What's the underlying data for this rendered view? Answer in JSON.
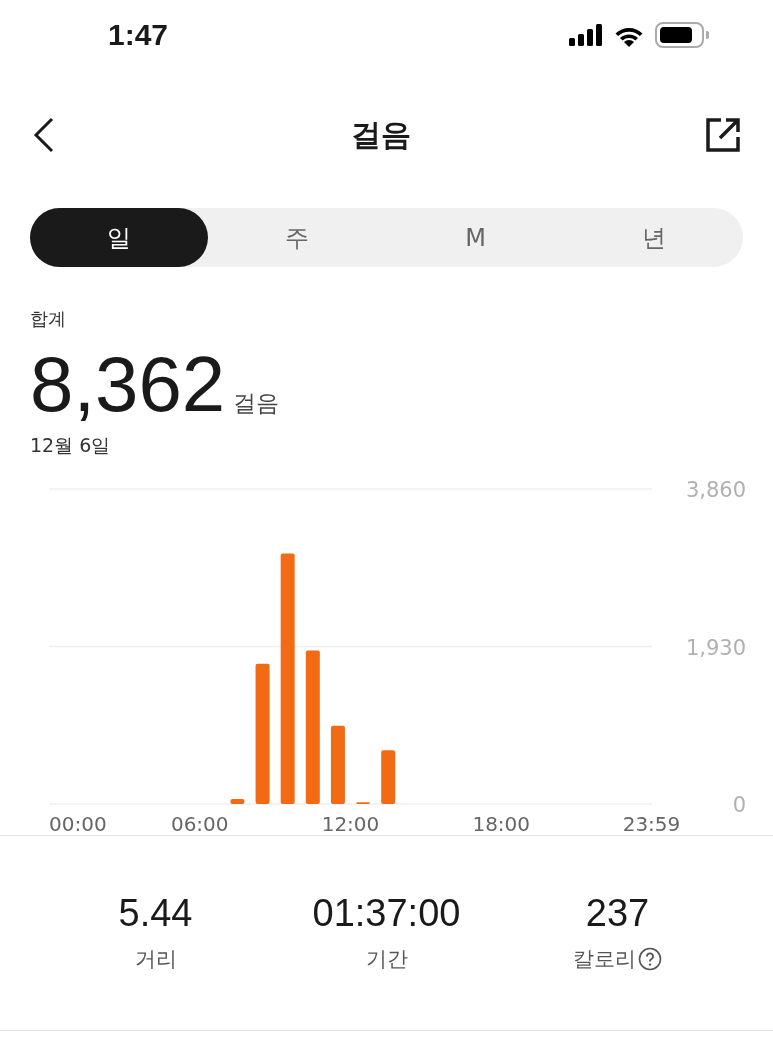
{
  "status_bar": {
    "time": "1:47"
  },
  "header": {
    "title": "걸음"
  },
  "tabs": [
    {
      "label": "일",
      "selected": true
    },
    {
      "label": "주",
      "selected": false
    },
    {
      "label": "M",
      "selected": false
    },
    {
      "label": "년",
      "selected": false
    }
  ],
  "summary": {
    "label": "합계",
    "value": "8,362",
    "unit": "걸음",
    "date": "12월 6일"
  },
  "chart_data": {
    "type": "bar",
    "x": [
      7.5,
      8.5,
      9.5,
      10.5,
      11.5,
      12.5,
      13.5
    ],
    "series": [
      {
        "color": "#f26b14",
        "values": [
          60,
          1720,
          3070,
          1880,
          960,
          20,
          660
        ]
      }
    ],
    "xlim": [
      0,
      24
    ],
    "ylim": [
      0,
      3860
    ],
    "xticks": [
      {
        "value": 0,
        "label": "00:00"
      },
      {
        "value": 6,
        "label": "06:00"
      },
      {
        "value": 12,
        "label": "12:00"
      },
      {
        "value": 18,
        "label": "18:00"
      },
      {
        "value": 23.98,
        "label": "23:59"
      }
    ],
    "yticks": [
      {
        "value": 0,
        "label": "0"
      },
      {
        "value": 1930,
        "label": "1,930"
      },
      {
        "value": 3860,
        "label": "3,860"
      }
    ]
  },
  "stats": [
    {
      "value": "5.44",
      "label": "거리",
      "kind": "plain"
    },
    {
      "value": "01:37:00",
      "label": "기간",
      "kind": "plain"
    },
    {
      "value": "237",
      "label": "칼로리",
      "kind": "help"
    }
  ]
}
